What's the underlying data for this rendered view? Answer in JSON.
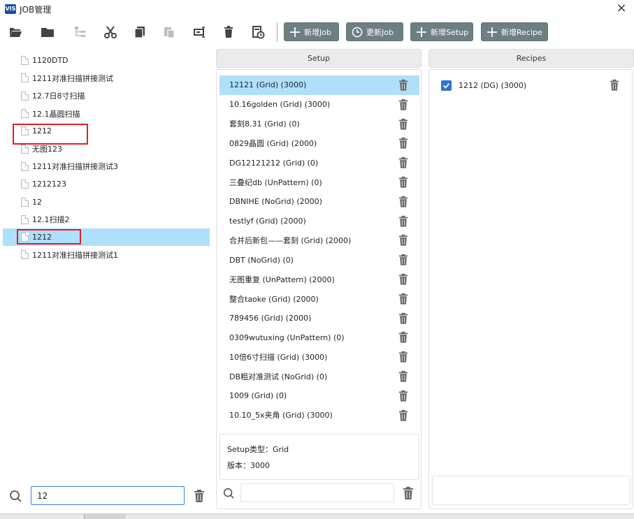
{
  "window": {
    "logo": "VIS",
    "title": "JOB管理",
    "close": "×"
  },
  "toolbar": {
    "icons": [
      "open-folder-icon",
      "folder-icon",
      "tree-icon",
      "cut-icon",
      "copy-icon",
      "paste-icon",
      "rename-icon",
      "delete-icon",
      "history-icon"
    ],
    "buttons": {
      "new_job": "新增Job",
      "update_job": "更新Job",
      "new_setup": "新增Setup",
      "new_recipe": "新增Recipe"
    },
    "button_color": "#6d7f83"
  },
  "tree": {
    "items": [
      {
        "label": "1120DTD"
      },
      {
        "label": "1211对准扫描拼接测试"
      },
      {
        "label": "12.7日8寸扫描"
      },
      {
        "label": "12.1晶圆扫描"
      },
      {
        "label": "1212"
      },
      {
        "label": "无图123"
      },
      {
        "label": "1211对准扫描拼接测试3"
      },
      {
        "label": "1212123"
      },
      {
        "label": "12"
      },
      {
        "label": "12.1扫描2"
      },
      {
        "label": "1212"
      },
      {
        "label": "1211对准扫描拼接测试1"
      }
    ],
    "selected_index": 10,
    "highlight_color": "#e0202a",
    "search_value": "12"
  },
  "setup": {
    "header": "Setup",
    "items": [
      {
        "label": "12121 (Grid) (3000)"
      },
      {
        "label": "10.16golden (Grid) (3000)"
      },
      {
        "label": "套刻8.31 (Grid) (0)"
      },
      {
        "label": "0829晶圆 (Grid) (2000)"
      },
      {
        "label": "DG12121212 (Grid) (0)"
      },
      {
        "label": "三叠纪db (UnPattern) (0)"
      },
      {
        "label": "DBNIHE  (NoGrid) (2000)"
      },
      {
        "label": "testlyf (Grid) (2000)"
      },
      {
        "label": "合并后新包——套刻 (Grid) (2000)"
      },
      {
        "label": "DBT (NoGrid) (0)"
      },
      {
        "label": "无图重复 (UnPattern) (2000)"
      },
      {
        "label": "整合taoke (Grid) (2000)"
      },
      {
        "label": "789456 (Grid) (2000)"
      },
      {
        "label": "0309wutuxing  (UnPattern) (0)"
      },
      {
        "label": "10倍6寸扫描 (Grid) (3000)"
      },
      {
        "label": "DB粗对准测试 (NoGrid) (0)"
      },
      {
        "label": "1009 (Grid) (0)"
      },
      {
        "label": "10.10_5x夹角 (Grid) (3000)"
      }
    ],
    "selected_index": 0,
    "info_type": "Setup类型：Grid",
    "info_version": "版本：3000",
    "search_value": ""
  },
  "recipes": {
    "header": "Recipes",
    "items": [
      {
        "label": "1212 (DG) (3000)",
        "checked": true
      }
    ]
  },
  "colors": {
    "selection": "#aee0fb",
    "checkbox": "#2f74d0",
    "input_focus": "#3b7fd6"
  }
}
